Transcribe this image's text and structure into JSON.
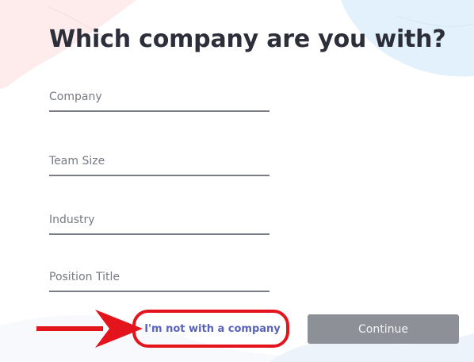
{
  "form": {
    "title": "Which company are you with?",
    "fields": [
      {
        "placeholder": "Company",
        "value": ""
      },
      {
        "placeholder": "Team Size",
        "value": ""
      },
      {
        "placeholder": "Industry",
        "value": ""
      },
      {
        "placeholder": "Position Title",
        "value": ""
      }
    ]
  },
  "actions": {
    "skip_label": "I'm not with a company",
    "continue_label": "Continue"
  },
  "colors": {
    "title": "#2c2f3a",
    "link": "#5a63b8",
    "button_disabled": "#8e9097",
    "annotation": "#e3141c",
    "underline": "#7a7d86"
  }
}
